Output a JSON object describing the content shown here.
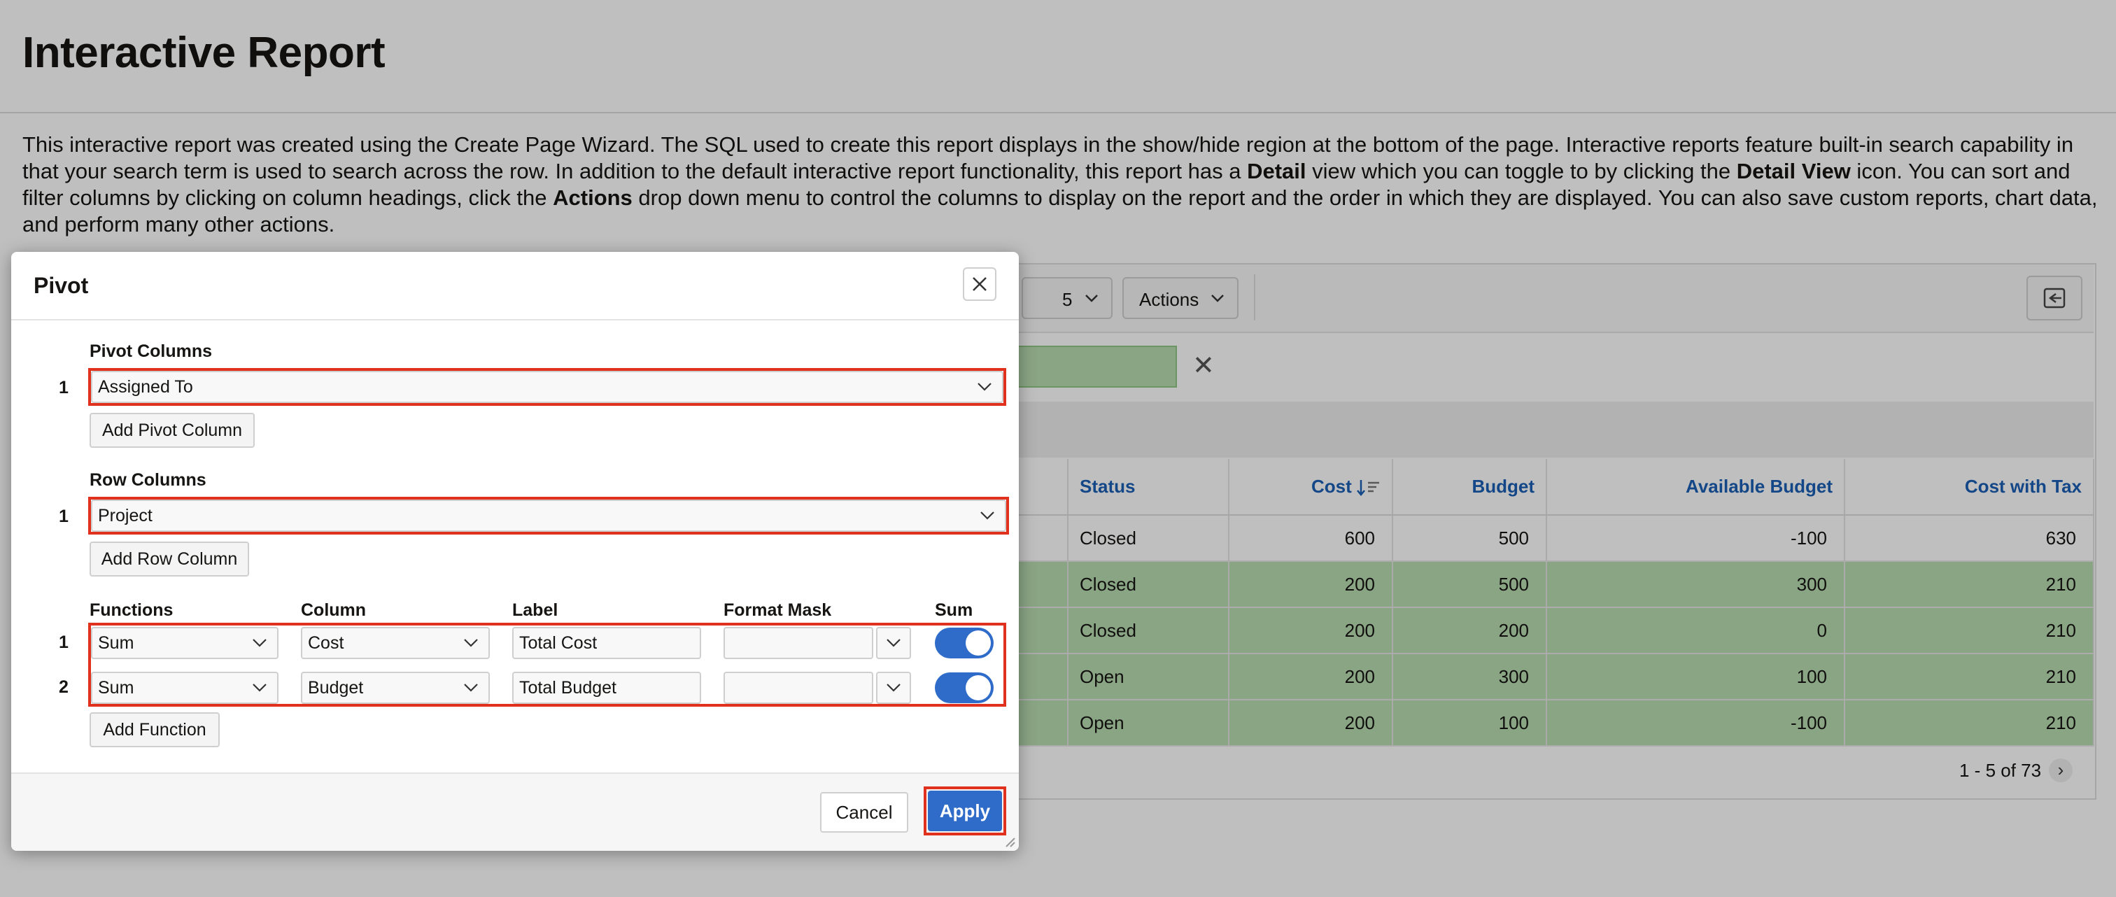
{
  "page": {
    "title": "Interactive Report",
    "intro_parts": {
      "p1": "This interactive report was created using the Create Page Wizard. The SQL used to create this report displays in the show/hide region at the bottom of the page. Interactive reports feature built-in search capability in that your search term is used to search across the row. In addition to the default interactive report functionality, this report has a ",
      "b1": "Detail",
      "p2": " view which you can toggle to by clicking the ",
      "b2": "Detail View",
      "p3": " icon. You can sort and filter columns by clicking on column headings, click the ",
      "b3": "Actions",
      "p4": " drop down menu to control the columns to display on the report and the order in which they are displayed. You can also save custom reports, chart data, and perform many other actions."
    }
  },
  "report": {
    "rows_per_page": "5",
    "actions_label": "Actions",
    "columns": [
      "Status",
      "Cost",
      "Budget",
      "Available Budget",
      "Cost with Tax"
    ],
    "rows": [
      {
        "status": "Closed",
        "cost": "600",
        "budget": "500",
        "available": "-100",
        "tax": "630"
      },
      {
        "status": "Closed",
        "cost": "200",
        "budget": "500",
        "available": "300",
        "tax": "210"
      },
      {
        "status": "Closed",
        "cost": "200",
        "budget": "200",
        "available": "0",
        "tax": "210"
      },
      {
        "status": "Open",
        "cost": "200",
        "budget": "300",
        "available": "100",
        "tax": "210"
      },
      {
        "status": "Open",
        "cost": "200",
        "budget": "100",
        "available": "-100",
        "tax": "210"
      }
    ],
    "pagination": "1 - 5 of 73"
  },
  "dialog": {
    "title": "Pivot",
    "pivot_columns_label": "Pivot Columns",
    "pivot_columns": [
      {
        "index": "1",
        "value": "Assigned To"
      }
    ],
    "add_pivot_column": "Add Pivot Column",
    "row_columns_label": "Row Columns",
    "row_columns": [
      {
        "index": "1",
        "value": "Project"
      }
    ],
    "add_row_column": "Add Row Column",
    "functions_headers": {
      "functions": "Functions",
      "column": "Column",
      "label": "Label",
      "format_mask": "Format Mask",
      "sum": "Sum"
    },
    "functions": [
      {
        "index": "1",
        "function": "Sum",
        "column": "Cost",
        "label": "Total Cost",
        "format_mask": "",
        "sum": true
      },
      {
        "index": "2",
        "function": "Sum",
        "column": "Budget",
        "label": "Total Budget",
        "format_mask": "",
        "sum": true
      }
    ],
    "add_function": "Add Function",
    "cancel": "Cancel",
    "apply": "Apply"
  },
  "colors": {
    "accent": "#2f6cc9",
    "highlight": "#e0301e",
    "row_highlight": "#b9dcb0"
  }
}
